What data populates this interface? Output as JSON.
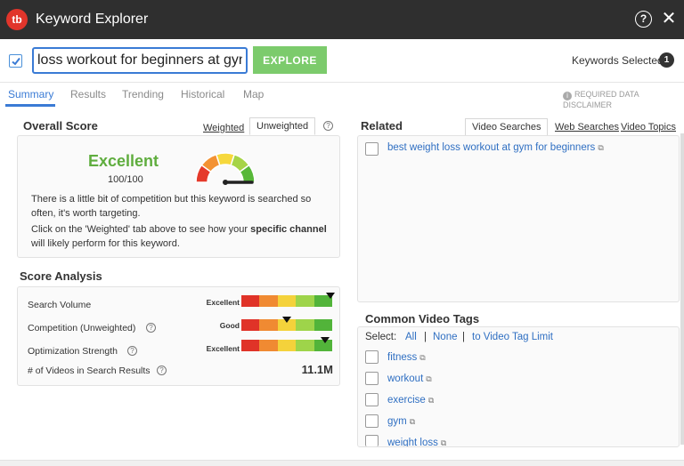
{
  "app": {
    "logo_text": "tb",
    "title": "Keyword Explorer",
    "help_glyph": "?",
    "close_glyph": "✕"
  },
  "search": {
    "value": "loss workout for beginners at gym",
    "explore_label": "EXPLORE",
    "keywords_selected_label": "Keywords Selected",
    "keywords_selected_count": "1"
  },
  "tabs": [
    "Summary",
    "Results",
    "Trending",
    "Historical",
    "Map"
  ],
  "disclaimer": "REQUIRED DATA DISCLAIMER",
  "overall": {
    "title": "Overall Score",
    "weighted_label": "Weighted",
    "unweighted_label": "Unweighted",
    "rating": "Excellent",
    "score": "100/100",
    "score_fraction": 1.0,
    "description": "There is a little bit of competition but this keyword is searched so often, it's worth targeting.",
    "hint_before": "Click on the 'Weighted' tab above to see how your ",
    "hint_bold": "specific channel",
    "hint_after": " will likely perform for this keyword.",
    "gauge_colors": [
      "#e53a2b",
      "#f39233",
      "#f6d83c",
      "#a6d447",
      "#58b839"
    ]
  },
  "analysis": {
    "title": "Score Analysis",
    "rows": [
      {
        "label": "Search Volume",
        "level": "Excellent",
        "marker_fraction": 0.98
      },
      {
        "label": "Competition (Unweighted)",
        "level": "Good",
        "marker_fraction": 0.5
      },
      {
        "label": "Optimization Strength",
        "level": "Excellent",
        "marker_fraction": 0.92
      }
    ],
    "videos_label": "# of Videos in Search Results",
    "videos_value": "11.1M",
    "bar_colors": [
      "#e03328",
      "#f08a32",
      "#f4d23b",
      "#9ed44a",
      "#52b43a"
    ]
  },
  "related": {
    "title": "Related",
    "tabs": [
      "Video Searches",
      "Web Searches",
      "Video Topics"
    ],
    "items": [
      "best weight loss workout at gym for beginners"
    ]
  },
  "tags": {
    "title": "Common Video Tags",
    "select_label": "Select:",
    "all_label": "All",
    "none_label": "None",
    "limit_label": "to Video Tag Limit",
    "separator": "|",
    "items": [
      "fitness",
      "workout",
      "exercise",
      "gym",
      "weight loss"
    ]
  }
}
